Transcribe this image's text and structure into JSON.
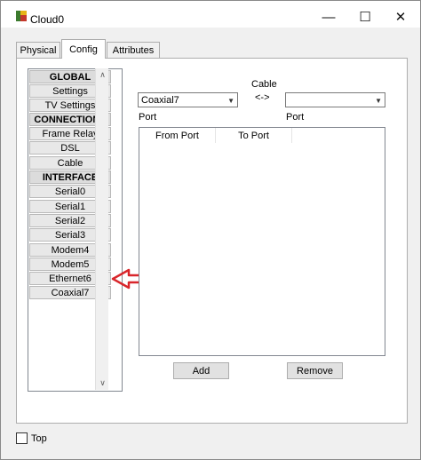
{
  "window": {
    "title": "Cloud0",
    "minimize_glyph": "—",
    "maximize_glyph": "☐",
    "close_glyph": "✕"
  },
  "tabs": [
    {
      "label": "Physical",
      "selected": false
    },
    {
      "label": "Config",
      "selected": true
    },
    {
      "label": "Attributes",
      "selected": false
    }
  ],
  "sidebar": {
    "items": [
      {
        "label": "GLOBAL",
        "type": "header"
      },
      {
        "label": "Settings",
        "type": "item"
      },
      {
        "label": "TV Settings",
        "type": "item"
      },
      {
        "label": "CONNECTIONS",
        "type": "header"
      },
      {
        "label": "Frame Relay",
        "type": "item"
      },
      {
        "label": "DSL",
        "type": "item"
      },
      {
        "label": "Cable",
        "type": "item"
      },
      {
        "label": "INTERFACE",
        "type": "header"
      },
      {
        "label": "Serial0",
        "type": "item"
      },
      {
        "label": "Serial1",
        "type": "item"
      },
      {
        "label": "Serial2",
        "type": "item"
      },
      {
        "label": "Serial3",
        "type": "item"
      },
      {
        "label": "Modem4",
        "type": "item"
      },
      {
        "label": "Modem5",
        "type": "item"
      },
      {
        "label": "Ethernet6",
        "type": "item"
      },
      {
        "label": "Coaxial7",
        "type": "item"
      }
    ]
  },
  "cable": {
    "title": "Cable",
    "arrow": "<->",
    "left_select_value": "Coaxial7",
    "right_select_value": "",
    "left_port_label": "Port",
    "right_port_label": "Port"
  },
  "table": {
    "columns": [
      "From Port",
      "To Port"
    ],
    "rows": []
  },
  "buttons": {
    "add": "Add",
    "remove": "Remove"
  },
  "footer": {
    "top_label": "Top",
    "top_checked": false
  },
  "annotation": {
    "arrow_color": "#d9262b",
    "points_to": "Ethernet6"
  }
}
